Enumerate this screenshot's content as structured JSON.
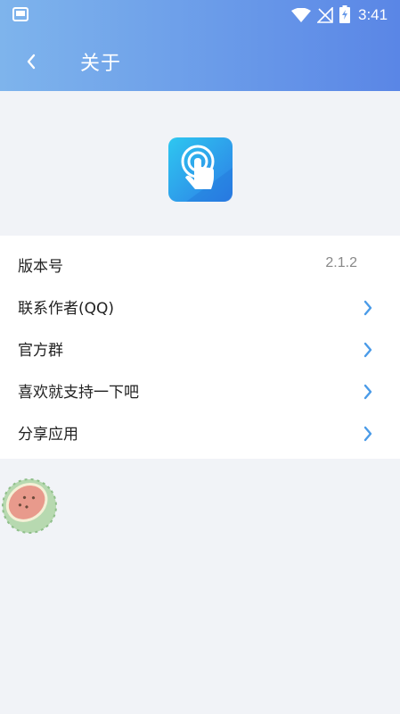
{
  "status_bar": {
    "time": "3:41",
    "icons": [
      "gallery-icon",
      "wifi-icon",
      "no-signal-icon",
      "battery-charging-icon"
    ]
  },
  "header": {
    "title": "关于",
    "back_icon": "chevron-left-icon"
  },
  "colors": {
    "header_gradient_start": "#7eb4ec",
    "header_gradient_end": "#5a86e6",
    "background": "#f1f3f7",
    "chevron": "#4a9be8"
  },
  "app_icon": "tap-gesture-icon",
  "list": {
    "items": [
      {
        "label": "版本号",
        "value": "2.1.2",
        "has_chevron": false
      },
      {
        "label": "联系作者(QQ)",
        "has_chevron": true
      },
      {
        "label": "官方群",
        "has_chevron": true
      },
      {
        "label": "喜欢就支持一下吧",
        "has_chevron": true
      },
      {
        "label": "分享应用",
        "has_chevron": true
      }
    ]
  },
  "decoration": "watermelon-icon"
}
